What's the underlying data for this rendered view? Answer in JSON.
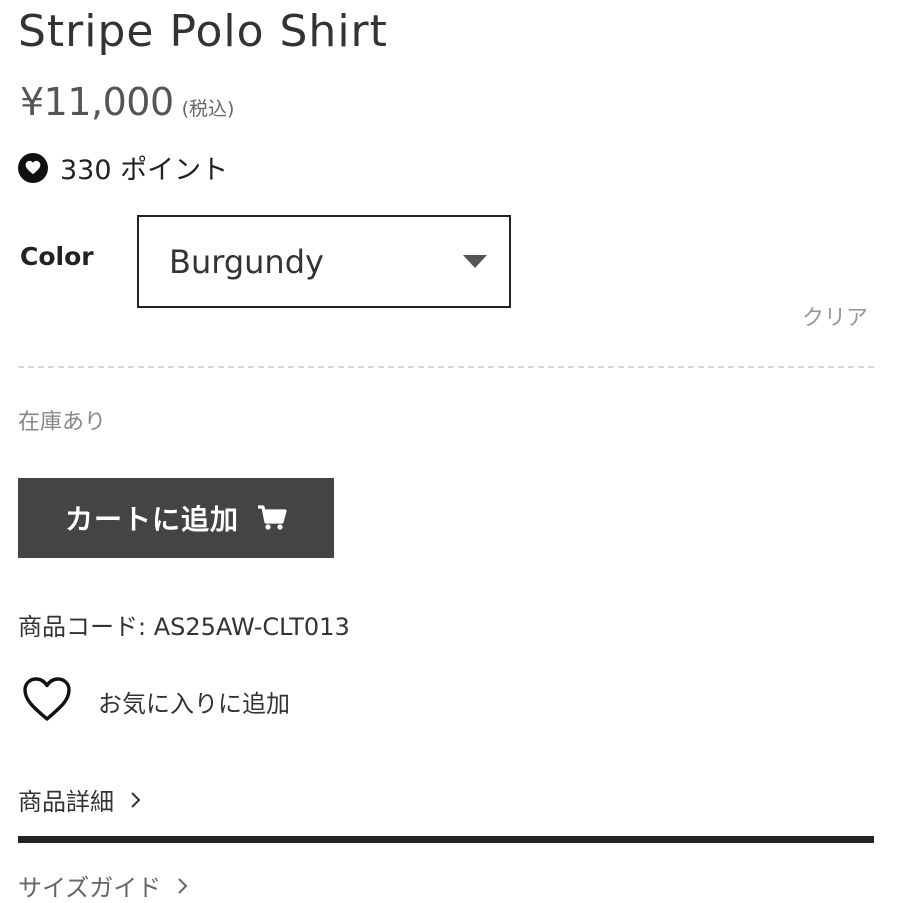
{
  "product": {
    "title": "Stripe Polo Shirt",
    "price": "¥11,000",
    "tax_note": "(税込)",
    "points": "330 ポイント",
    "sku": "商品コード: AS25AW-CLT013"
  },
  "options": {
    "color_label": "Color",
    "color_selected": "Burgundy",
    "clear_label": "クリア"
  },
  "stock": {
    "status": "在庫あり"
  },
  "actions": {
    "add_to_cart_label": "カートに追加",
    "favorite_label": "お気に入りに追加"
  },
  "sections": {
    "details_label": "商品詳細",
    "size_guide_label": "サイズガイド"
  },
  "icons": {
    "points": "heart-filled-icon",
    "select_caret": "caret-down-icon",
    "cart": "cart-icon",
    "favorite": "heart-outline-icon",
    "chevron": "chevron-right-icon"
  }
}
